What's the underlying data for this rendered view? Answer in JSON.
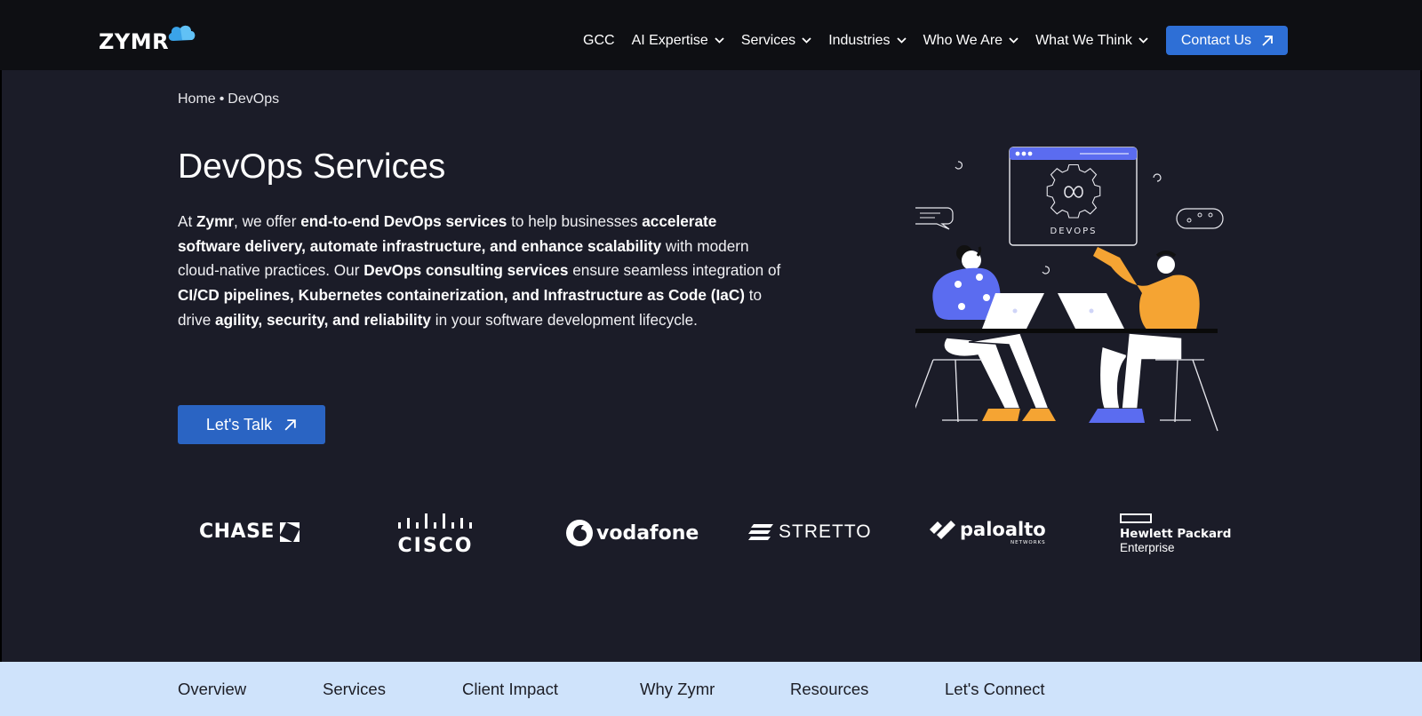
{
  "header": {
    "logo_text": "ZYMR",
    "nav": [
      {
        "label": "GCC",
        "has_dropdown": false
      },
      {
        "label": "AI Expertise",
        "has_dropdown": true
      },
      {
        "label": "Services",
        "has_dropdown": true
      },
      {
        "label": "Industries",
        "has_dropdown": true
      },
      {
        "label": "Who We Are",
        "has_dropdown": true
      },
      {
        "label": "What We Think",
        "has_dropdown": true
      }
    ],
    "contact_label": "Contact Us"
  },
  "breadcrumb": {
    "home": "Home",
    "separator": "•",
    "current": "DevOps"
  },
  "hero": {
    "title": "DevOps Services",
    "description": [
      {
        "t": "At ",
        "b": false
      },
      {
        "t": "Zymr",
        "b": true
      },
      {
        "t": ", we offer ",
        "b": false
      },
      {
        "t": "end-to-end DevOps services",
        "b": true
      },
      {
        "t": " to help businesses ",
        "b": false
      },
      {
        "t": "accelerate software delivery, automate infrastructure, and enhance scalability",
        "b": true
      },
      {
        "t": " with modern cloud-native practices. Our ",
        "b": false
      },
      {
        "t": "DevOps consulting services",
        "b": true
      },
      {
        "t": " ensure seamless integration of ",
        "b": false
      },
      {
        "t": "CI/CD pipelines, Kubernetes containerization, and Infrastructure as Code (IaC)",
        "b": true
      },
      {
        "t": " to drive ",
        "b": false
      },
      {
        "t": "agility, security, and reliability",
        "b": true
      },
      {
        "t": " in your software development lifecycle.",
        "b": false
      }
    ],
    "cta_label": "Let's Talk",
    "illustration_label": "DEVOPS"
  },
  "clients": {
    "chase": "CHASE",
    "cisco": "CISCO",
    "vodafone": "vodafone",
    "stretto": "STRETTO",
    "paloalto": "paloalto",
    "paloalto_sub": "NETWORKS",
    "hpe_line1": "Hewlett Packard",
    "hpe_line2": "Enterprise"
  },
  "tabs": [
    "Overview",
    "Services",
    "Client Impact",
    "Why Zymr",
    "Resources",
    "Let's Connect"
  ],
  "colors": {
    "page_bg": "#1b1c28",
    "header_bg": "#0e0f13",
    "accent_blue": "#2e6fd6",
    "tabbar_bg": "#cfe3fb",
    "illus_purple": "#5b6cf0",
    "illus_orange": "#f5a433"
  }
}
